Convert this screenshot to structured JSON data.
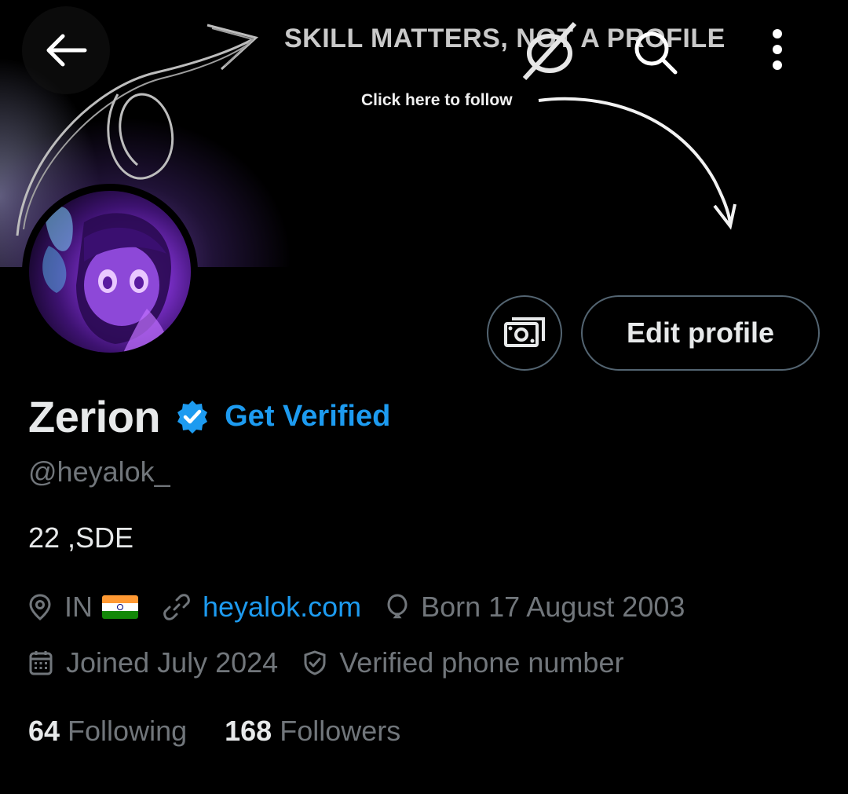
{
  "banner": {
    "slogan": "SKILL MATTERS, NOT A PROFILE",
    "hint": "Click here to follow"
  },
  "nav": {
    "back_icon": "arrow-left-icon",
    "search_icon": "search-icon",
    "more_icon": "more-vertical-icon"
  },
  "actions": {
    "tips_icon": "money-icon",
    "edit_profile_label": "Edit profile"
  },
  "profile": {
    "display_name": "Zerion",
    "get_verified_label": "Get Verified",
    "handle": "@heyalok_",
    "bio": "22 ,SDE",
    "location": "IN",
    "website": "heyalok.com",
    "birthday": "Born 17 August 2003",
    "joined": "Joined July 2024",
    "verified_phone": "Verified phone number"
  },
  "stats": {
    "following_count": "64",
    "following_label": "Following",
    "followers_count": "168",
    "followers_label": "Followers"
  },
  "colors": {
    "accent": "#1d9bf0",
    "text_primary": "#e7e9ea",
    "text_secondary": "#71767b",
    "border": "#536471",
    "background": "#000000"
  }
}
